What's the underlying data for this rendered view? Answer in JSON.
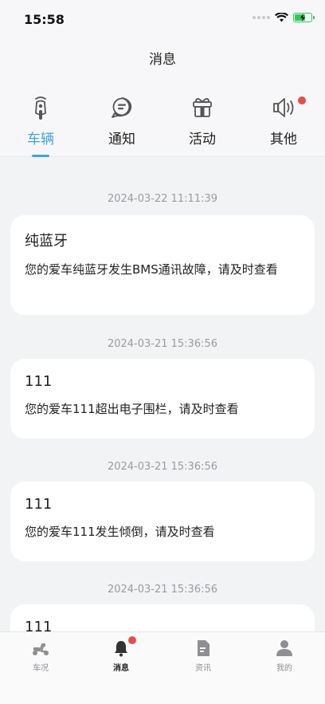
{
  "status_bar": {
    "time": "15:58"
  },
  "header": {
    "title": "消息"
  },
  "tabs": [
    {
      "label": "车辆",
      "icon": "scooter-icon",
      "active": true
    },
    {
      "label": "通知",
      "icon": "chat-bubble-icon",
      "active": false
    },
    {
      "label": "活动",
      "icon": "gift-icon",
      "active": false
    },
    {
      "label": "其他",
      "icon": "speaker-icon",
      "active": false,
      "badge": true
    }
  ],
  "messages": [
    {
      "timestamp": "2024-03-22 11:11:39",
      "title": "纯蓝牙",
      "body": "您的爱车纯蓝牙发生BMS通讯故障，请及时查看"
    },
    {
      "timestamp": "2024-03-21 15:36:56",
      "title": "111",
      "body": "您的爱车111超出电子围栏，请及时查看"
    },
    {
      "timestamp": "2024-03-21 15:36:56",
      "title": "111",
      "body": "您的爱车111发生倾倒，请及时查看"
    },
    {
      "timestamp": "2024-03-21 15:36:56",
      "title": "111",
      "body": ""
    }
  ],
  "bottom_nav": [
    {
      "label": "车况",
      "icon": "scooter-icon",
      "active": false
    },
    {
      "label": "消息",
      "icon": "bell-icon",
      "active": true,
      "badge": true
    },
    {
      "label": "资讯",
      "icon": "document-icon",
      "active": false
    },
    {
      "label": "我的",
      "icon": "user-icon",
      "active": false
    }
  ],
  "colors": {
    "accent": "#40a6d8",
    "badge": "#e2504c",
    "battery": "#34c759",
    "background": "#f2f3f5"
  }
}
